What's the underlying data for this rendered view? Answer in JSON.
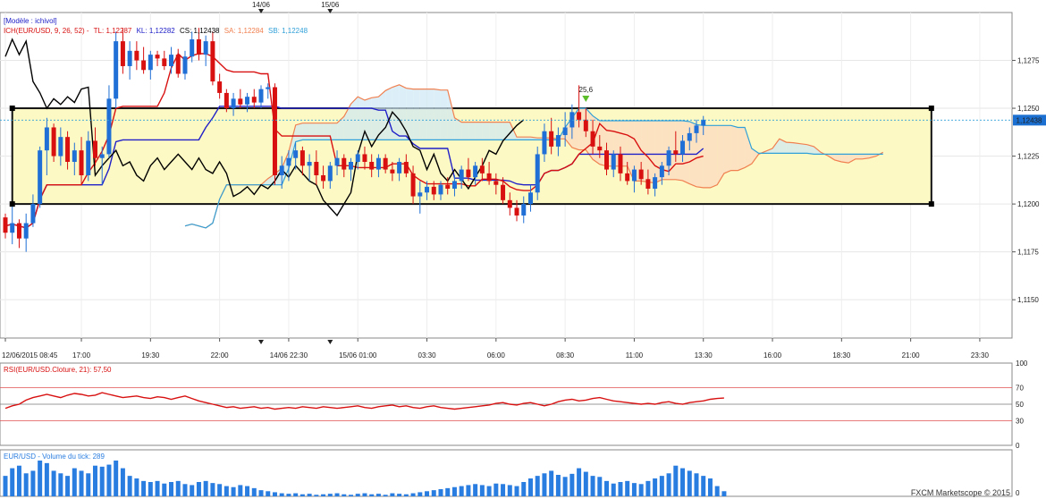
{
  "chart_data": {
    "type": "candlestick",
    "instrument": "EUR/USD",
    "model_label": "[Modèle : ichivol]",
    "ichimoku": {
      "label": "ICH(EUR/USD, 9, 26, 52) -",
      "tl_label": "TL: 1,12287",
      "kl_label": "KL: 1,12282",
      "cs_label": "CS: 1,12438",
      "sa_label": "SA: 1,12284",
      "sb_label": "SB: 1,12248"
    },
    "colors": {
      "up": "#1f6fd6",
      "down": "#d81010",
      "tenkan": "#d81010",
      "kijun": "#2020c8",
      "chikou": "#000000",
      "senkou_a": "#f08050",
      "senkou_b": "#30a0d8",
      "kumo_bull": "#cde8f5",
      "kumo_bear": "#fbd8c0",
      "box_fill": "#fdf9c4",
      "rsi": "#d81010",
      "volume": "#2a7de0"
    },
    "price_axis": {
      "min": 1.113,
      "max": 1.13,
      "ticks": [
        "1,1275",
        "1,1250",
        "1,1225",
        "1,1200",
        "1,1175",
        "1,1150"
      ],
      "tick_values": [
        1.1275,
        1.125,
        1.1225,
        1.12,
        1.1175,
        1.115
      ],
      "current_label": "1,12438",
      "current_value": 1.12438
    },
    "time_axis": {
      "labels": [
        "12/06/2015 08:45",
        "17:00",
        "19:30",
        "22:00",
        "14/06 22:30",
        "15/06 01:00",
        "03:30",
        "06:00",
        "08:30",
        "11:00",
        "13:30",
        "16:00",
        "18:30",
        "21:00",
        "23:30"
      ],
      "label_index": [
        0,
        11,
        21,
        31,
        41,
        51,
        61,
        71,
        81,
        91,
        101,
        111,
        121,
        131,
        141
      ]
    },
    "date_markers": [
      {
        "label": "14/06",
        "index": 37
      },
      {
        "label": "15/06",
        "index": 47
      }
    ],
    "box": {
      "upper": 1.125,
      "lower": 1.12,
      "start_index": 1,
      "end_index": 134
    },
    "annotation": {
      "label": "25,6",
      "index": 84
    },
    "candles": [
      [
        1.1193,
        1.1195,
        1.1182,
        1.1185
      ],
      [
        1.1185,
        1.12,
        1.1179,
        1.119
      ],
      [
        1.119,
        1.1192,
        1.1177,
        1.1182
      ],
      [
        1.1182,
        1.1195,
        1.1175,
        1.119
      ],
      [
        1.119,
        1.1205,
        1.1188,
        1.12
      ],
      [
        1.12,
        1.123,
        1.1198,
        1.1228
      ],
      [
        1.1228,
        1.1245,
        1.1215,
        1.124
      ],
      [
        1.124,
        1.1242,
        1.1222,
        1.1225
      ],
      [
        1.1225,
        1.124,
        1.122,
        1.1235
      ],
      [
        1.1235,
        1.1238,
        1.1218,
        1.1222
      ],
      [
        1.1222,
        1.1232,
        1.1215,
        1.1228
      ],
      [
        1.1228,
        1.1235,
        1.121,
        1.1215
      ],
      [
        1.1215,
        1.1238,
        1.1212,
        1.1233
      ],
      [
        1.1233,
        1.124,
        1.122,
        1.1224
      ],
      [
        1.1224,
        1.123,
        1.121,
        1.1226
      ],
      [
        1.1226,
        1.1262,
        1.1224,
        1.1255
      ],
      [
        1.1255,
        1.129,
        1.125,
        1.1285
      ],
      [
        1.1285,
        1.1292,
        1.1268,
        1.1272
      ],
      [
        1.1272,
        1.1285,
        1.1265,
        1.128
      ],
      [
        1.128,
        1.1285,
        1.127,
        1.1275
      ],
      [
        1.1275,
        1.1282,
        1.1268,
        1.127
      ],
      [
        1.127,
        1.128,
        1.1265,
        1.1278
      ],
      [
        1.1278,
        1.128,
        1.1272,
        1.1276
      ],
      [
        1.1276,
        1.128,
        1.127,
        1.1272
      ],
      [
        1.1272,
        1.1282,
        1.1268,
        1.1278
      ],
      [
        1.1278,
        1.1281,
        1.1266,
        1.1268
      ],
      [
        1.1268,
        1.128,
        1.1265,
        1.1277
      ],
      [
        1.1277,
        1.129,
        1.1274,
        1.1286
      ],
      [
        1.1286,
        1.1292,
        1.1275,
        1.1278
      ],
      [
        1.1278,
        1.1288,
        1.1272,
        1.1285
      ],
      [
        1.1285,
        1.129,
        1.1262,
        1.1264
      ],
      [
        1.1264,
        1.1268,
        1.1255,
        1.1258
      ],
      [
        1.1258,
        1.126,
        1.1248,
        1.125
      ],
      [
        1.125,
        1.1258,
        1.1246,
        1.1255
      ],
      [
        1.1255,
        1.126,
        1.125,
        1.1252
      ],
      [
        1.1252,
        1.1258,
        1.1248,
        1.1256
      ],
      [
        1.1256,
        1.126,
        1.125,
        1.1253
      ],
      [
        1.1253,
        1.1262,
        1.125,
        1.126
      ],
      [
        1.126,
        1.1263,
        1.1255,
        1.1261
      ],
      [
        1.1261,
        1.1263,
        1.121,
        1.1215
      ],
      [
        1.1215,
        1.1225,
        1.1208,
        1.122
      ],
      [
        1.122,
        1.1228,
        1.1212,
        1.1224
      ],
      [
        1.1224,
        1.1232,
        1.1218,
        1.1228
      ],
      [
        1.1228,
        1.123,
        1.1215,
        1.122
      ],
      [
        1.122,
        1.1226,
        1.1212,
        1.1222
      ],
      [
        1.1222,
        1.1228,
        1.121,
        1.1215
      ],
      [
        1.1215,
        1.122,
        1.1208,
        1.1212
      ],
      [
        1.1212,
        1.1222,
        1.1208,
        1.122
      ],
      [
        1.122,
        1.1228,
        1.1215,
        1.1224
      ],
      [
        1.1224,
        1.1226,
        1.1214,
        1.1218
      ],
      [
        1.1218,
        1.1224,
        1.1212,
        1.1222
      ],
      [
        1.1222,
        1.1228,
        1.1218,
        1.1226
      ],
      [
        1.1226,
        1.123,
        1.1218,
        1.1222
      ],
      [
        1.1222,
        1.1226,
        1.1214,
        1.1218
      ],
      [
        1.1218,
        1.1226,
        1.1214,
        1.1224
      ],
      [
        1.1224,
        1.1226,
        1.1216,
        1.1218
      ],
      [
        1.1218,
        1.1222,
        1.1212,
        1.1216
      ],
      [
        1.1216,
        1.1224,
        1.1212,
        1.1222
      ],
      [
        1.1222,
        1.1226,
        1.1214,
        1.1216
      ],
      [
        1.1216,
        1.122,
        1.12,
        1.1204
      ],
      [
        1.1204,
        1.1212,
        1.1195,
        1.1206
      ],
      [
        1.1206,
        1.1212,
        1.1202,
        1.1209
      ],
      [
        1.1209,
        1.1212,
        1.1202,
        1.1205
      ],
      [
        1.1205,
        1.1212,
        1.1202,
        1.121
      ],
      [
        1.121,
        1.1214,
        1.1205,
        1.1208
      ],
      [
        1.1208,
        1.1215,
        1.1204,
        1.1212
      ],
      [
        1.1212,
        1.122,
        1.1208,
        1.1218
      ],
      [
        1.1218,
        1.1224,
        1.1212,
        1.1214
      ],
      [
        1.1214,
        1.1222,
        1.121,
        1.122
      ],
      [
        1.122,
        1.1224,
        1.1212,
        1.1216
      ],
      [
        1.1216,
        1.1222,
        1.121,
        1.1212
      ],
      [
        1.1212,
        1.1216,
        1.1205,
        1.121
      ],
      [
        1.121,
        1.1214,
        1.12,
        1.1202
      ],
      [
        1.1202,
        1.1206,
        1.1194,
        1.1198
      ],
      [
        1.1198,
        1.1202,
        1.1191,
        1.1194
      ],
      [
        1.1194,
        1.1204,
        1.119,
        1.12
      ],
      [
        1.12,
        1.121,
        1.1196,
        1.1206
      ],
      [
        1.1206,
        1.123,
        1.1202,
        1.1226
      ],
      [
        1.1226,
        1.1242,
        1.1222,
        1.1238
      ],
      [
        1.1238,
        1.1245,
        1.1226,
        1.123
      ],
      [
        1.123,
        1.124,
        1.1225,
        1.1236
      ],
      [
        1.1236,
        1.1248,
        1.123,
        1.124
      ],
      [
        1.124,
        1.1252,
        1.1234,
        1.1248
      ],
      [
        1.1248,
        1.1262,
        1.124,
        1.1244
      ],
      [
        1.1244,
        1.125,
        1.1235,
        1.1238
      ],
      [
        1.1238,
        1.1244,
        1.1226,
        1.123
      ],
      [
        1.123,
        1.1236,
        1.1224,
        1.1228
      ],
      [
        1.1228,
        1.1232,
        1.1215,
        1.1218
      ],
      [
        1.1218,
        1.1228,
        1.1214,
        1.1226
      ],
      [
        1.1226,
        1.123,
        1.1212,
        1.1216
      ],
      [
        1.1216,
        1.1222,
        1.121,
        1.1212
      ],
      [
        1.1212,
        1.122,
        1.1206,
        1.1218
      ],
      [
        1.1218,
        1.1222,
        1.121,
        1.1213
      ],
      [
        1.1213,
        1.1218,
        1.1205,
        1.1208
      ],
      [
        1.1208,
        1.1216,
        1.1204,
        1.1214
      ],
      [
        1.1214,
        1.1222,
        1.121,
        1.122
      ],
      [
        1.122,
        1.123,
        1.1215,
        1.1228
      ],
      [
        1.1228,
        1.1238,
        1.1222,
        1.1226
      ],
      [
        1.1226,
        1.1236,
        1.1222,
        1.1233
      ],
      [
        1.1233,
        1.124,
        1.1228,
        1.1237
      ],
      [
        1.1237,
        1.1244,
        1.1232,
        1.1241
      ],
      [
        1.1241,
        1.1246,
        1.1236,
        1.1244
      ]
    ],
    "rsi": {
      "label": "RSI(EUR/USD.Cloture, 21): 57,50",
      "ticks": [
        "100",
        "70",
        "50",
        "30",
        "0"
      ],
      "tick_values": [
        100,
        70,
        50,
        30,
        0
      ],
      "upper": 70,
      "lower": 30,
      "values": [
        45,
        48,
        50,
        55,
        58,
        60,
        62,
        60,
        58,
        61,
        63,
        62,
        60,
        61,
        64,
        62,
        60,
        58,
        59,
        60,
        58,
        57,
        59,
        58,
        56,
        58,
        60,
        57,
        54,
        52,
        50,
        48,
        46,
        47,
        45,
        46,
        47,
        45,
        46,
        44,
        45,
        46,
        45,
        47,
        46,
        45,
        47,
        46,
        45,
        46,
        47,
        48,
        46,
        45,
        47,
        48,
        49,
        47,
        48,
        46,
        45,
        47,
        48,
        46,
        45,
        44,
        45,
        46,
        47,
        48,
        49,
        51,
        52,
        50,
        49,
        51,
        52,
        50,
        48,
        50,
        53,
        55,
        56,
        54,
        55,
        57,
        58,
        56,
        54,
        53,
        52,
        51,
        50,
        51,
        50,
        52,
        53,
        51,
        50,
        52,
        53,
        54,
        56,
        57,
        57.5
      ]
    },
    "volume": {
      "label": "EUR/USD - Volume du tick: 289",
      "axis_label": "0",
      "values": [
        40,
        55,
        60,
        45,
        50,
        70,
        65,
        50,
        45,
        40,
        55,
        50,
        45,
        60,
        58,
        62,
        70,
        55,
        40,
        35,
        30,
        28,
        30,
        25,
        28,
        30,
        24,
        22,
        28,
        30,
        26,
        24,
        20,
        18,
        22,
        20,
        16,
        12,
        10,
        8,
        6,
        5,
        6,
        4,
        5,
        3,
        4,
        5,
        6,
        4,
        3,
        5,
        6,
        4,
        5,
        3,
        6,
        5,
        4,
        6,
        8,
        10,
        12,
        14,
        16,
        18,
        20,
        22,
        24,
        22,
        20,
        25,
        24,
        22,
        20,
        28,
        35,
        40,
        45,
        50,
        42,
        38,
        44,
        55,
        48,
        40,
        38,
        30,
        25,
        28,
        30,
        26,
        24,
        30,
        35,
        40,
        45,
        60,
        55,
        50,
        45,
        40,
        35,
        20,
        10
      ]
    },
    "footer": "FXCM Marketscope © 2015"
  }
}
